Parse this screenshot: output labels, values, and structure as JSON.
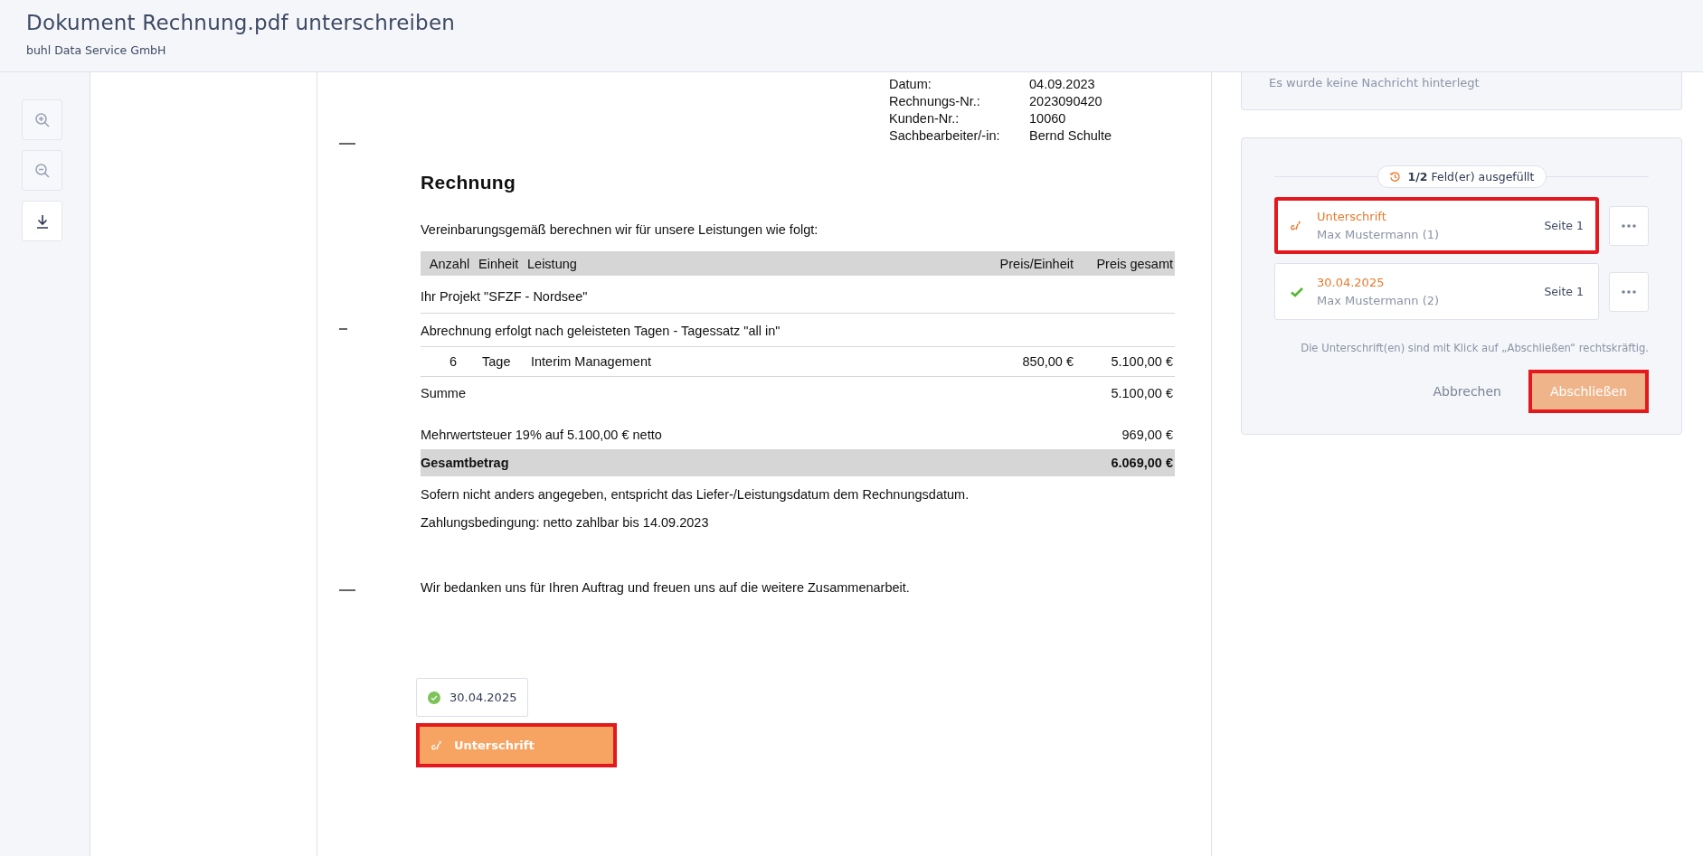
{
  "header": {
    "title": "Dokument Rechnung.pdf unterschreiben",
    "subtitle": "buhl Data Service GmbH"
  },
  "toolbar": [
    {
      "kind": "zoom-in",
      "disabled": true
    },
    {
      "kind": "zoom-out",
      "disabled": true
    },
    {
      "kind": "download",
      "disabled": false
    }
  ],
  "document": {
    "info": [
      {
        "label": "Datum:",
        "value": "04.09.2023"
      },
      {
        "label": "Rechnungs-Nr.:",
        "value": "2023090420"
      },
      {
        "label": "Kunden-Nr.:",
        "value": "10060"
      },
      {
        "label": "Sachbearbeiter/-in:",
        "value": "Bernd Schulte"
      }
    ],
    "heading": "Rechnung",
    "intro": "Vereinbarungsgemäß berechnen wir für unsere Leistungen wie folgt:",
    "columns": [
      "Anzahl",
      "Einheit",
      "Leistung",
      "Preis/Einheit",
      "Preis gesamt"
    ],
    "lines": [
      {
        "kind": "section",
        "text": "Ihr Projekt \"SFZF - Nordsee\""
      },
      {
        "kind": "section",
        "text": "Abrechnung erfolgt nach geleisteten Tagen - Tagessatz \"all in\""
      },
      {
        "kind": "item",
        "cells": [
          "6",
          "Tage",
          "Interim Management",
          "850,00 €",
          "5.100,00 €"
        ]
      },
      {
        "kind": "sum",
        "label": "Summe",
        "amount": "5.100,00 €"
      },
      {
        "kind": "tax",
        "label": "Mehrwertsteuer 19% auf 5.100,00 € netto",
        "amount": "969,00 €"
      },
      {
        "kind": "total",
        "label": "Gesamtbetrag",
        "amount": "6.069,00 €"
      }
    ],
    "notes": [
      "Sofern nicht anders angegeben, entspricht das Liefer-/Leistungsdatum dem Rechnungsdatum.",
      "Zahlungsbedingung: netto zahlbar bis 14.09.2023"
    ],
    "closing": "Wir bedanken uns für Ihren Auftrag und freuen uns auf die weitere Zusammenarbeit.",
    "placed_fields": [
      {
        "text": "30.04.2025",
        "filled": true,
        "highlighted": false
      },
      {
        "text": "Unterschrift",
        "filled": false,
        "highlighted": true
      }
    ]
  },
  "message_card": {
    "text": "Es wurde keine Nachricht hinterlegt"
  },
  "progress": {
    "text": "**1/2** Feld(er) ausgefüllt"
  },
  "fields": [
    {
      "title": "Unterschrift",
      "signer": "Max Mustermann (1)",
      "page": "Seite 1",
      "filled": false,
      "highlighted": true
    },
    {
      "title": "30.04.2025",
      "signer": "Max Mustermann (2)",
      "page": "Seite 1",
      "filled": true,
      "highlighted": false
    }
  ],
  "note": "Die Unterschrift(en) sind mit Klick auf „Abschließen“ rechtskräftig.",
  "buttons": [
    {
      "kind": "secondary",
      "label": "Abbrechen",
      "highlighted": false
    },
    {
      "kind": "primary",
      "label": "Abschließen",
      "highlighted": true
    }
  ]
}
